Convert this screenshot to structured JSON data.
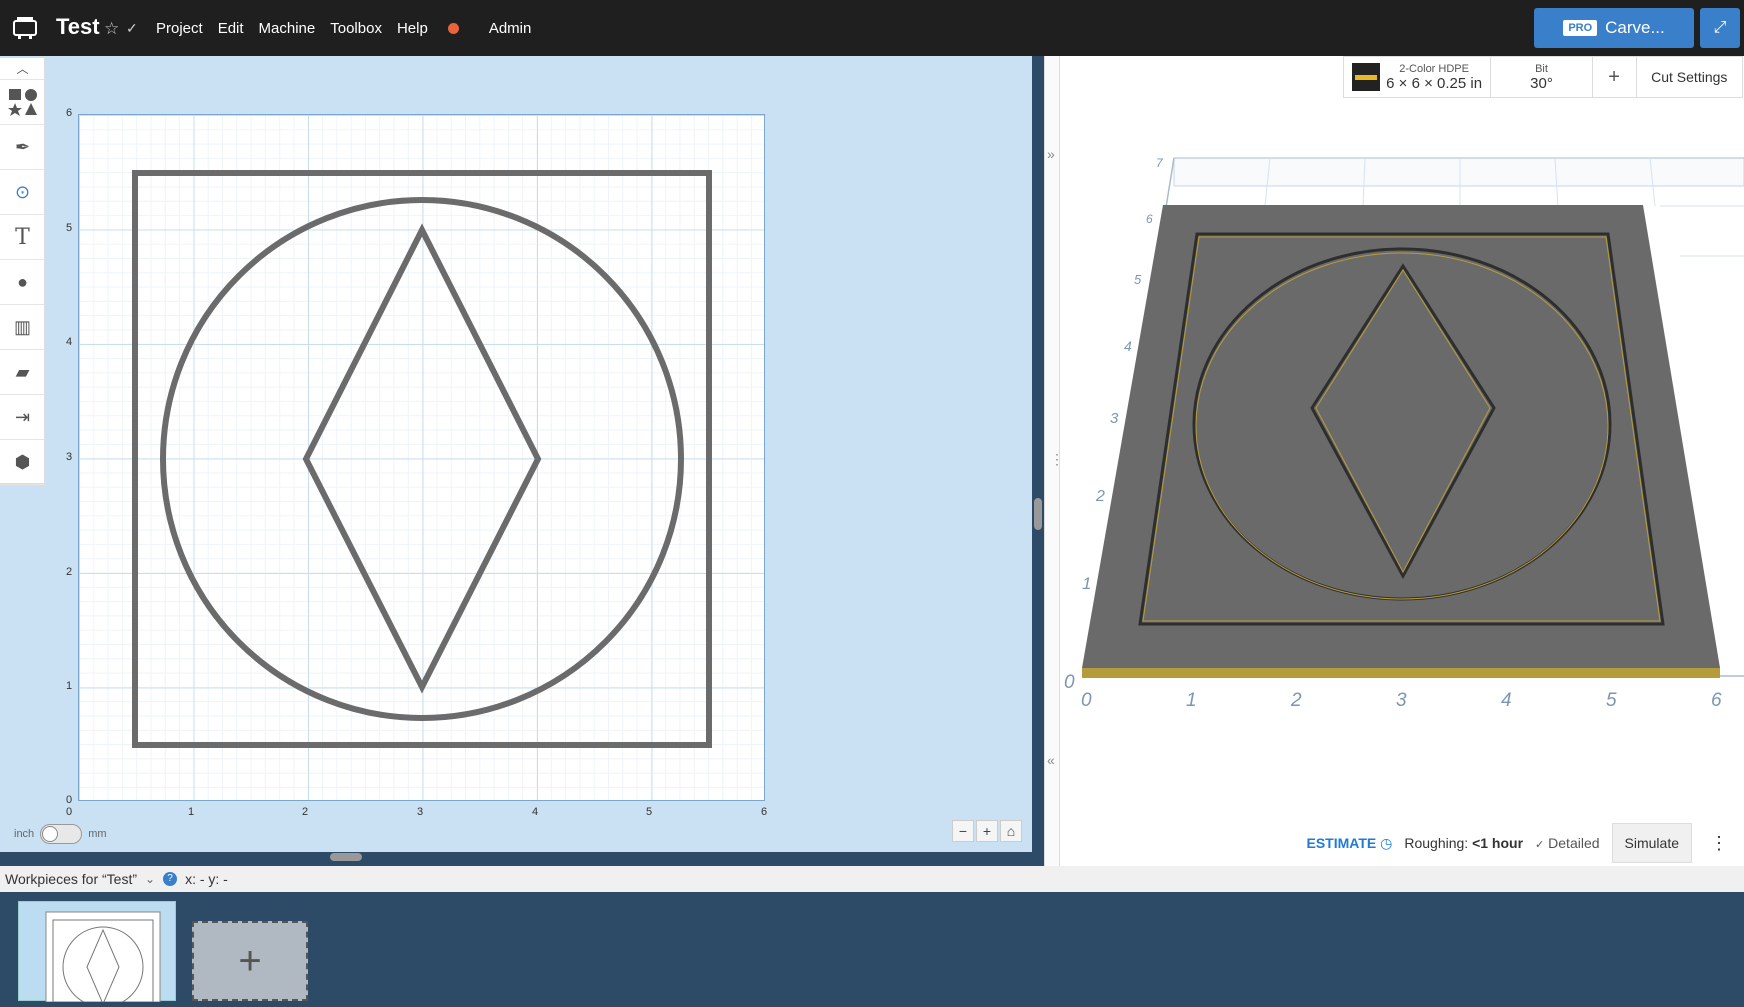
{
  "header": {
    "title": "Test",
    "menu": [
      "Project",
      "Edit",
      "Machine",
      "Toolbox",
      "Help",
      "Admin"
    ],
    "carve_label": "Carve...",
    "pro_label": "PRO"
  },
  "material": {
    "name": "2-Color HDPE",
    "size": "6 × 6 × 0.25 in",
    "bit_label": "Bit",
    "bit_value": "30°",
    "add_label": "+",
    "cut_settings_label": "Cut Settings"
  },
  "canvas": {
    "x_ticks": [
      "0",
      "1",
      "2",
      "3",
      "4",
      "5",
      "6"
    ],
    "y_ticks": [
      "0",
      "1",
      "2",
      "3",
      "4",
      "5",
      "6"
    ]
  },
  "units": {
    "left": "inch",
    "right": "mm"
  },
  "preview": {
    "x_ticks": [
      "0",
      "1",
      "2",
      "3",
      "4",
      "5",
      "6"
    ],
    "y_ticks": [
      "0",
      "1",
      "2",
      "3",
      "4",
      "5",
      "6",
      "7"
    ]
  },
  "estimate": {
    "label": "ESTIMATE",
    "roughing_label": "Roughing:",
    "roughing_value": "<1 hour",
    "detailed_label": "Detailed",
    "simulate_label": "Simulate"
  },
  "workpieces": {
    "title": "Workpieces for “Test”",
    "coords": "x: - y: -"
  }
}
